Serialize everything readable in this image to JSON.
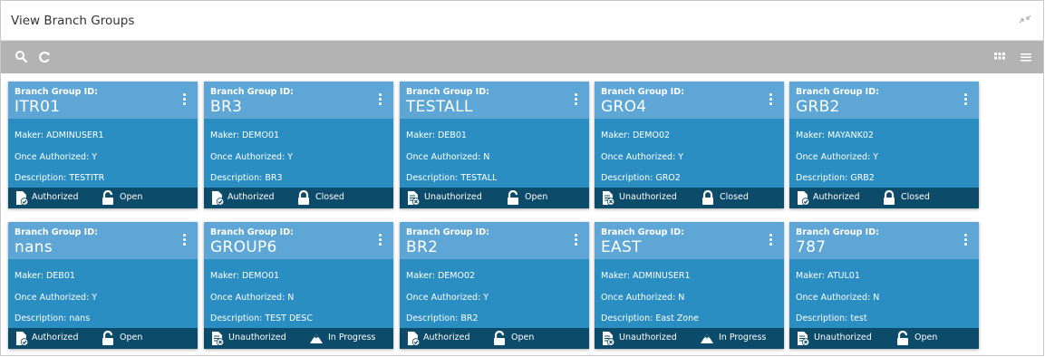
{
  "window": {
    "title": "View Branch Groups"
  },
  "toolbar": {
    "left_icons": [
      "search-icon",
      "refresh-icon"
    ],
    "right_icons": [
      "grid-view-icon",
      "list-view-icon"
    ]
  },
  "colors": {
    "card_body": "#2a8ec2",
    "card_header": "#5ea6d6",
    "card_footer": "#0d4b6b",
    "toolbar": "#b3b3b3"
  },
  "cards": [
    {
      "label": "Branch Group ID:",
      "id": "ITR01",
      "maker": "Maker: ADMINUSER1",
      "once_authorized": "Once Authorized: Y",
      "description": "Description: TESTITR",
      "auth_status": "Authorized",
      "record_status": "Open"
    },
    {
      "label": "Branch Group ID:",
      "id": "BR3",
      "maker": "Maker: DEMO01",
      "once_authorized": "Once Authorized: Y",
      "description": "Description: BR3",
      "auth_status": "Authorized",
      "record_status": "Closed"
    },
    {
      "label": "Branch Group ID:",
      "id": "TESTALL",
      "maker": "Maker: DEB01",
      "once_authorized": "Once Authorized: N",
      "description": "Description: TESTALL",
      "auth_status": "Unauthorized",
      "record_status": "Open"
    },
    {
      "label": "Branch Group ID:",
      "id": "GRO4",
      "maker": "Maker: DEMO02",
      "once_authorized": "Once Authorized: Y",
      "description": "Description: GRO2",
      "auth_status": "Unauthorized",
      "record_status": "Closed"
    },
    {
      "label": "Branch Group ID:",
      "id": "GRB2",
      "maker": "Maker: MAYANK02",
      "once_authorized": "Once Authorized: Y",
      "description": "Description: GRB2",
      "auth_status": "Authorized",
      "record_status": "Closed"
    },
    {
      "label": "Branch Group ID:",
      "id": "nans",
      "maker": "Maker: DEB01",
      "once_authorized": "Once Authorized: Y",
      "description": "Description: nans",
      "auth_status": "Authorized",
      "record_status": "Open"
    },
    {
      "label": "Branch Group ID:",
      "id": "GROUP6",
      "maker": "Maker: DEMO01",
      "once_authorized": "Once Authorized: N",
      "description": "Description: TEST DESC",
      "auth_status": "Unauthorized",
      "record_status": "In Progress"
    },
    {
      "label": "Branch Group ID:",
      "id": "BR2",
      "maker": "Maker: DEMO02",
      "once_authorized": "Once Authorized: Y",
      "description": "Description: BR2",
      "auth_status": "Authorized",
      "record_status": "Open"
    },
    {
      "label": "Branch Group ID:",
      "id": "EAST",
      "maker": "Maker: ADMINUSER1",
      "once_authorized": "Once Authorized: N",
      "description": "Description: East Zone",
      "auth_status": "Unauthorized",
      "record_status": "In Progress"
    },
    {
      "label": "Branch Group ID:",
      "id": "787",
      "maker": "Maker: ATUL01",
      "once_authorized": "Once Authorized: N",
      "description": "Description: test",
      "auth_status": "Unauthorized",
      "record_status": "Open"
    }
  ]
}
